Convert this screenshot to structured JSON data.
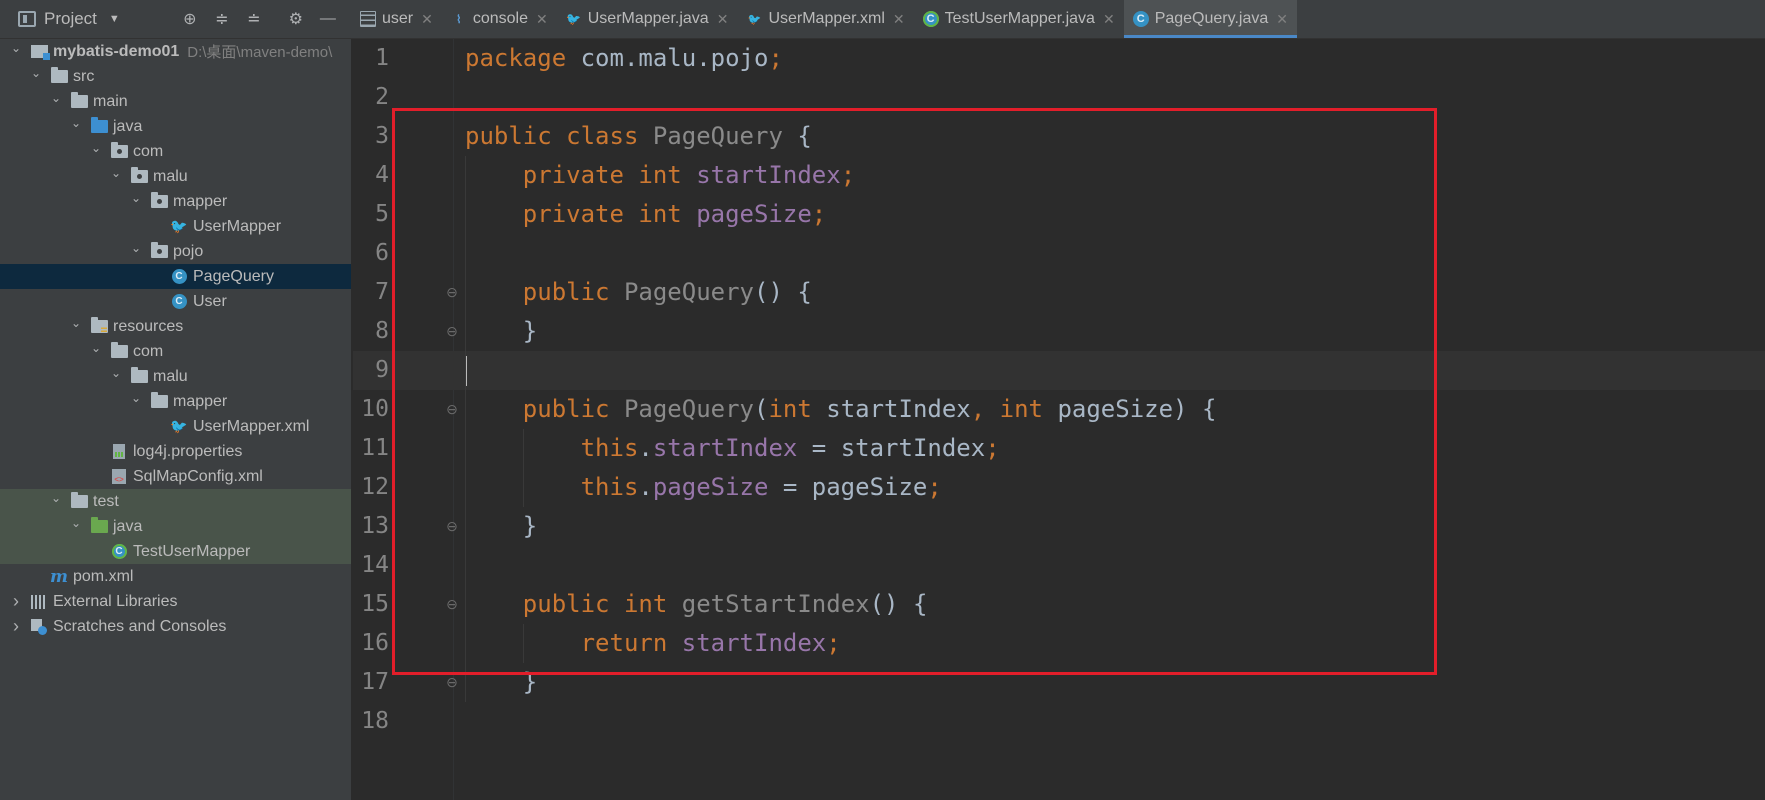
{
  "sidebar_header": {
    "title": "Project",
    "tools": [
      "target-icon",
      "expand-all-icon",
      "collapse-all-icon",
      "gear-icon",
      "minimize-icon"
    ]
  },
  "tabs": [
    {
      "label": "user",
      "icon": "table-icon",
      "active": false
    },
    {
      "label": "console",
      "icon": "console-icon",
      "active": false
    },
    {
      "label": "UserMapper.java",
      "icon": "mybatis-mapper-icon",
      "active": false
    },
    {
      "label": "UserMapper.xml",
      "icon": "mybatis-xml-icon",
      "active": false
    },
    {
      "label": "TestUserMapper.java",
      "icon": "test-class-icon",
      "active": false
    },
    {
      "label": "PageQuery.java",
      "icon": "class-icon",
      "active": true
    }
  ],
  "tree": [
    {
      "depth": 0,
      "arrow": "down",
      "icon": "module",
      "label": "mybatis-demo01",
      "extra": "D:\\桌面\\maven-demo\\"
    },
    {
      "depth": 1,
      "arrow": "down",
      "icon": "folder",
      "label": "src"
    },
    {
      "depth": 2,
      "arrow": "down",
      "icon": "folder",
      "label": "main"
    },
    {
      "depth": 3,
      "arrow": "down",
      "icon": "folder-blue",
      "label": "java"
    },
    {
      "depth": 4,
      "arrow": "down",
      "icon": "package",
      "label": "com"
    },
    {
      "depth": 5,
      "arrow": "down",
      "icon": "package",
      "label": "malu"
    },
    {
      "depth": 6,
      "arrow": "down",
      "icon": "package",
      "label": "mapper"
    },
    {
      "depth": 7,
      "arrow": "none",
      "icon": "mapper",
      "label": "UserMapper"
    },
    {
      "depth": 6,
      "arrow": "down",
      "icon": "package",
      "label": "pojo"
    },
    {
      "depth": 7,
      "arrow": "none",
      "icon": "class",
      "label": "PageQuery",
      "selected": true
    },
    {
      "depth": 7,
      "arrow": "none",
      "icon": "class",
      "label": "User"
    },
    {
      "depth": 3,
      "arrow": "down",
      "icon": "resources",
      "label": "resources"
    },
    {
      "depth": 4,
      "arrow": "down",
      "icon": "folder",
      "label": "com"
    },
    {
      "depth": 5,
      "arrow": "down",
      "icon": "folder",
      "label": "malu"
    },
    {
      "depth": 6,
      "arrow": "down",
      "icon": "folder",
      "label": "mapper"
    },
    {
      "depth": 7,
      "arrow": "none",
      "icon": "xml-bird",
      "label": "UserMapper.xml"
    },
    {
      "depth": 4,
      "arrow": "none",
      "icon": "properties",
      "label": "log4j.properties"
    },
    {
      "depth": 4,
      "arrow": "none",
      "icon": "xml",
      "label": "SqlMapConfig.xml"
    },
    {
      "depth": 2,
      "arrow": "down",
      "icon": "folder",
      "label": "test",
      "testsel": true
    },
    {
      "depth": 3,
      "arrow": "down",
      "icon": "folder-green",
      "label": "java",
      "testsel": true
    },
    {
      "depth": 4,
      "arrow": "none",
      "icon": "test-class",
      "label": "TestUserMapper",
      "testsel": true
    },
    {
      "depth": 1,
      "arrow": "none",
      "icon": "maven",
      "label": "pom.xml"
    },
    {
      "depth": 0,
      "arrow": "right",
      "icon": "libraries",
      "label": "External Libraries"
    },
    {
      "depth": 0,
      "arrow": "right",
      "icon": "scratches",
      "label": "Scratches and Consoles"
    }
  ],
  "editor": {
    "current_line": 9,
    "lines": [
      {
        "n": "1",
        "tokens": [
          [
            "kw",
            "package "
          ],
          [
            "plain",
            "com.malu.pojo"
          ],
          [
            "semi",
            ";"
          ]
        ]
      },
      {
        "n": "2",
        "tokens": []
      },
      {
        "n": "3",
        "tokens": [
          [
            "kw",
            "public class "
          ],
          [
            "fn",
            "PageQuery"
          ],
          [
            "plain",
            " {"
          ]
        ]
      },
      {
        "n": "4",
        "tokens": [
          [
            "plain",
            "    "
          ],
          [
            "kw",
            "private int "
          ],
          [
            "fld",
            "startIndex"
          ],
          [
            "semi",
            ";"
          ]
        ]
      },
      {
        "n": "5",
        "tokens": [
          [
            "plain",
            "    "
          ],
          [
            "kw",
            "private int "
          ],
          [
            "fld",
            "pageSize"
          ],
          [
            "semi",
            ";"
          ]
        ]
      },
      {
        "n": "6",
        "tokens": []
      },
      {
        "n": "7",
        "tokens": [
          [
            "plain",
            "    "
          ],
          [
            "kw",
            "public "
          ],
          [
            "fn",
            "PageQuery"
          ],
          [
            "plain",
            "() {"
          ]
        ]
      },
      {
        "n": "8",
        "tokens": [
          [
            "plain",
            "    }"
          ]
        ]
      },
      {
        "n": "9",
        "tokens": []
      },
      {
        "n": "10",
        "tokens": [
          [
            "plain",
            "    "
          ],
          [
            "kw",
            "public "
          ],
          [
            "fn",
            "PageQuery"
          ],
          [
            "plain",
            "("
          ],
          [
            "kw",
            "int "
          ],
          [
            "plain",
            "startIndex"
          ],
          [
            "semi",
            ", "
          ],
          [
            "kw",
            "int "
          ],
          [
            "plain",
            "pageSize) {"
          ]
        ]
      },
      {
        "n": "11",
        "tokens": [
          [
            "plain",
            "        "
          ],
          [
            "kw",
            "this"
          ],
          [
            "plain",
            "."
          ],
          [
            "fld",
            "startIndex"
          ],
          [
            "plain",
            " = startIndex"
          ],
          [
            "semi",
            ";"
          ]
        ]
      },
      {
        "n": "12",
        "tokens": [
          [
            "plain",
            "        "
          ],
          [
            "kw",
            "this"
          ],
          [
            "plain",
            "."
          ],
          [
            "fld",
            "pageSize"
          ],
          [
            "plain",
            " = pageSize"
          ],
          [
            "semi",
            ";"
          ]
        ]
      },
      {
        "n": "13",
        "tokens": [
          [
            "plain",
            "    }"
          ]
        ]
      },
      {
        "n": "14",
        "tokens": []
      },
      {
        "n": "15",
        "tokens": [
          [
            "plain",
            "    "
          ],
          [
            "kw",
            "public int "
          ],
          [
            "fn",
            "getStartIndex"
          ],
          [
            "plain",
            "() {"
          ]
        ]
      },
      {
        "n": "16",
        "tokens": [
          [
            "plain",
            "        "
          ],
          [
            "kw",
            "return "
          ],
          [
            "fld",
            "startIndex"
          ],
          [
            "semi",
            ";"
          ]
        ]
      },
      {
        "n": "17",
        "tokens": [
          [
            "plain",
            "    }"
          ]
        ]
      },
      {
        "n": "18",
        "tokens": []
      }
    ],
    "fold_markers": [
      7,
      8,
      10,
      13,
      15,
      17
    ]
  },
  "colors": {
    "keyword": "#cc7832",
    "field": "#9876aa",
    "method_decl": "#8a8a8a",
    "text": "#a9b7c6",
    "highlight_box": "#e21e2a",
    "selection": "#0d293e"
  }
}
